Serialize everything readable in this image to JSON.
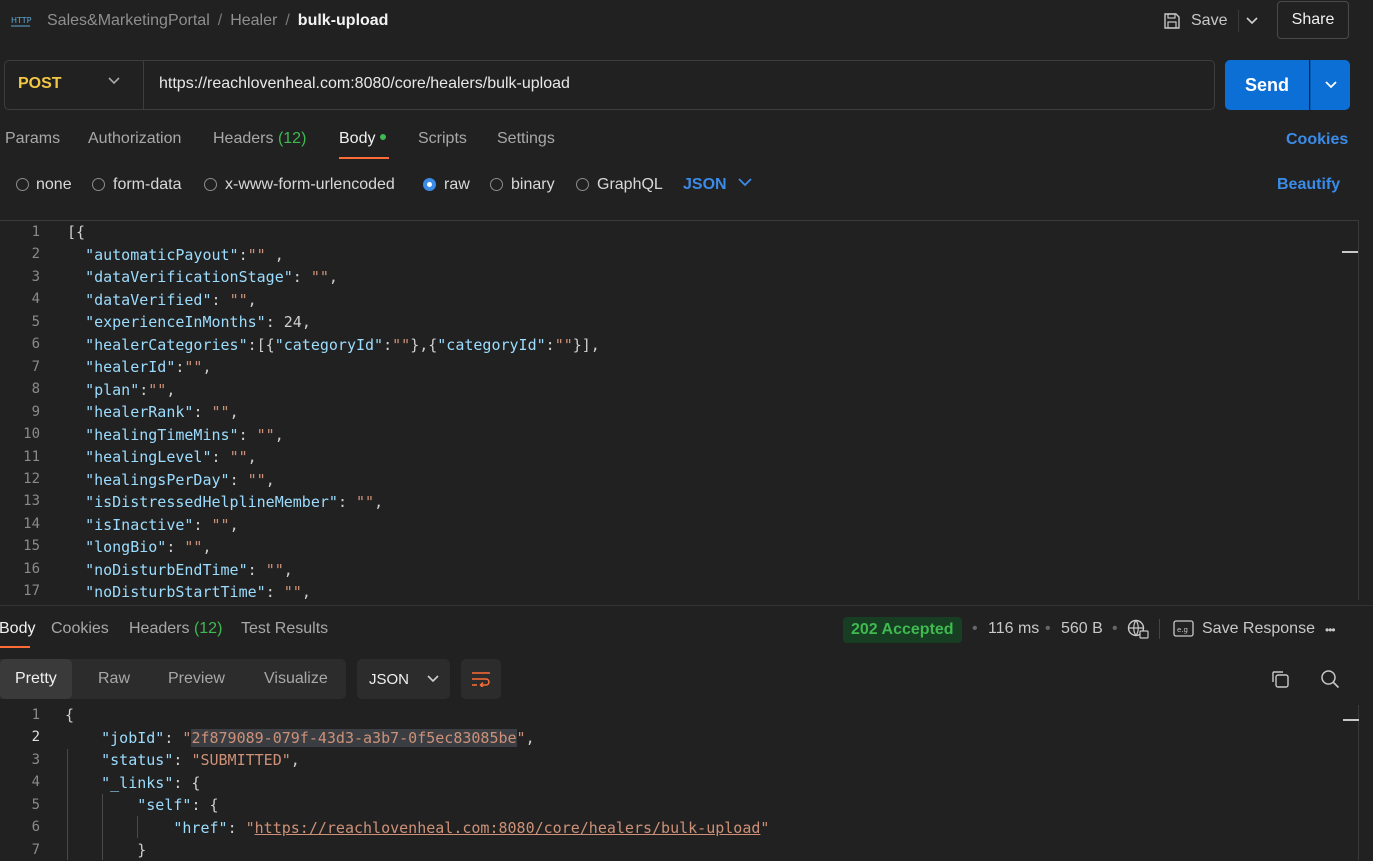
{
  "header": {
    "http_icon_label": "HTTP",
    "breadcrumb": [
      "Sales&MarketingPortal",
      "Healer",
      "bulk-upload"
    ],
    "breadcrumb_sep": "/",
    "save_label": "Save",
    "share_label": "Share"
  },
  "request": {
    "method": "POST",
    "url": "https://reachlovenheal.com:8080/core/healers/bulk-upload",
    "send_label": "Send",
    "tabs": {
      "params": "Params",
      "authorization": "Authorization",
      "headers": "Headers",
      "headers_count": "(12)",
      "body": "Body",
      "scripts": "Scripts",
      "settings": "Settings"
    },
    "cookies_label": "Cookies",
    "body_types": [
      "none",
      "form-data",
      "x-www-form-urlencoded",
      "raw",
      "binary",
      "GraphQL"
    ],
    "selected_body_type": "raw",
    "language": "JSON",
    "beautify_label": "Beautify",
    "line_numbers": [
      "1",
      "2",
      "3",
      "4",
      "5",
      "6",
      "7",
      "8",
      "9",
      "10",
      "11",
      "12",
      "13",
      "14",
      "15",
      "16",
      "17"
    ]
  },
  "response": {
    "tabs": {
      "body": "Body",
      "cookies": "Cookies",
      "headers": "Headers",
      "headers_count": "(12)",
      "test_results": "Test Results"
    },
    "status": "202 Accepted",
    "time": "116 ms",
    "size": "560 B",
    "save_response_label": "Save Response",
    "more_label": "•••",
    "views": [
      "Pretty",
      "Raw",
      "Preview",
      "Visualize"
    ],
    "format": "JSON",
    "line_numbers": [
      "1",
      "2",
      "3",
      "4",
      "5",
      "6",
      "7"
    ],
    "job_id": "2f879089-079f-43d3-a3b7-0f5ec83085be",
    "status_value": "SUBMITTED",
    "href": "https://reachlovenheal.com:8080/core/healers/bulk-upload"
  },
  "colors": {
    "accent_blue": "#0b6fd6",
    "link_blue": "#3b8be8",
    "method_yellow": "#f2c744",
    "status_green": "#3fb950",
    "tab_orange": "#ff6c37"
  }
}
